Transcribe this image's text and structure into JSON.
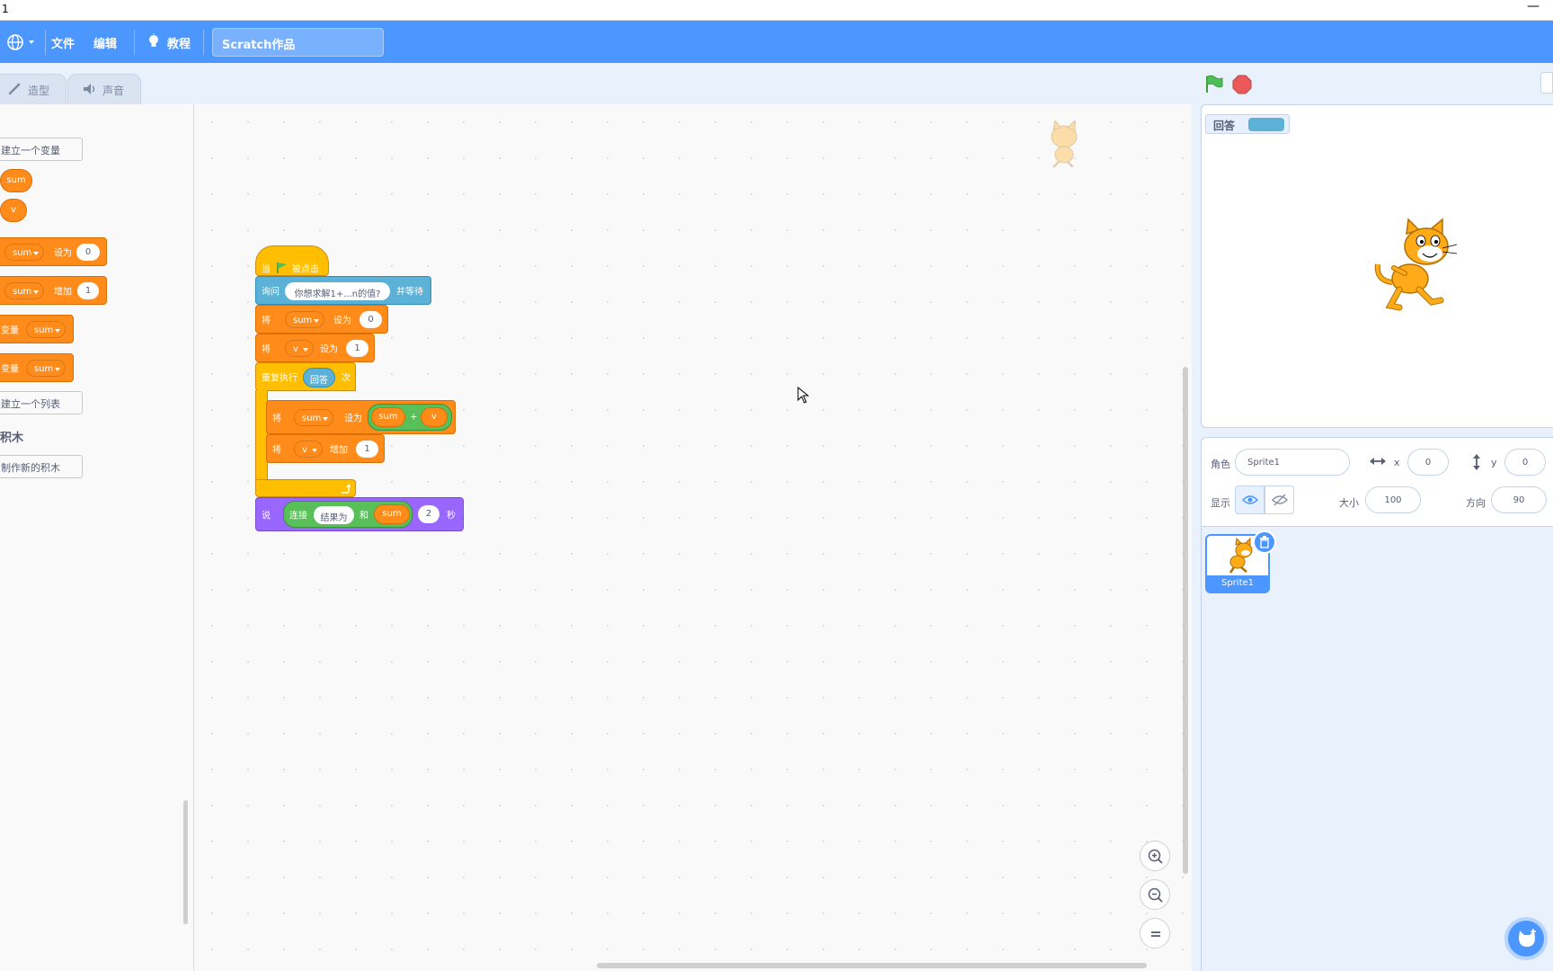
{
  "window": {
    "title": "1",
    "minimize": "—"
  },
  "menubar": {
    "file": "文件",
    "edit": "编辑",
    "tutorial": "教程",
    "project_title": "Scratch作品"
  },
  "tabs": {
    "costumes": "造型",
    "sounds": "声音"
  },
  "palette": {
    "make_variable": "建立一个变量",
    "var1": "sum",
    "var2": "v",
    "set_block": {
      "var": "sum",
      "label": "设为",
      "value": "0"
    },
    "change_block": {
      "var": "sum",
      "label": "增加",
      "value": "1"
    },
    "show_var": {
      "prefix": "变量",
      "var": "sum"
    },
    "hide_var": {
      "prefix": "变量",
      "var": "sum"
    },
    "make_list": "建立一个列表",
    "my_blocks_heading": "积木",
    "make_block": "制作新的积木"
  },
  "script": {
    "hat": {
      "when": "当",
      "clicked": "被点击"
    },
    "ask": {
      "label": "询问",
      "question": "你想求解1+...n的值?",
      "wait": "并等待"
    },
    "set_sum": {
      "label": "将",
      "var": "sum",
      "to": "设为",
      "value": "0"
    },
    "set_v": {
      "label": "将",
      "var": "v",
      "to": "设为",
      "value": "1"
    },
    "repeat": {
      "label": "重复执行",
      "arg": "回答",
      "times": "次"
    },
    "inner_set": {
      "label": "将",
      "var": "sum",
      "to": "设为",
      "left": "sum",
      "op": "+",
      "right": "v"
    },
    "inner_change": {
      "label": "将",
      "var": "v",
      "by": "增加",
      "value": "1"
    },
    "say": {
      "label": "说",
      "join": "连接",
      "text": "结果为",
      "and": "和",
      "var": "sum",
      "secs": "2",
      "secs_label": "秒"
    }
  },
  "stage": {
    "monitor_label": "回答"
  },
  "sprite_info": {
    "sprite_label": "角色",
    "sprite_name": "Sprite1",
    "x_label": "x",
    "x_value": "0",
    "y_label": "y",
    "y_value": "0",
    "show_label": "显示",
    "size_label": "大小",
    "size_value": "100",
    "direction_label": "方向",
    "direction_value": "90"
  },
  "sprites": [
    {
      "name": "Sprite1"
    }
  ]
}
